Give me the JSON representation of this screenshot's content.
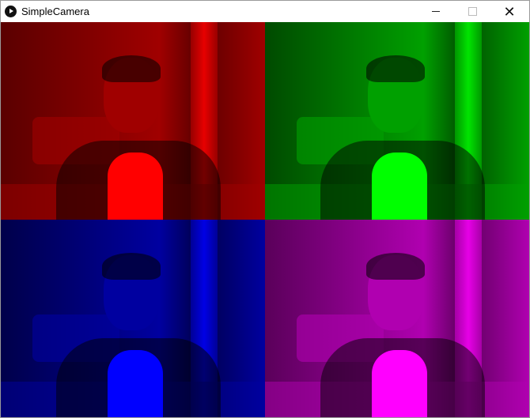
{
  "window": {
    "title": "SimpleCamera",
    "minimize": "minimize",
    "maximize": "maximize",
    "close": "close"
  },
  "feeds": [
    {
      "channel": "red",
      "color": "#ff0000",
      "dark": "#5a0000",
      "mid": "#a00000"
    },
    {
      "channel": "green",
      "color": "#00ff00",
      "dark": "#004a00",
      "mid": "#00a000"
    },
    {
      "channel": "blue",
      "color": "#0000ff",
      "dark": "#00004a",
      "mid": "#0000a0"
    },
    {
      "channel": "magenta",
      "color": "#ff00ff",
      "dark": "#5a005a",
      "mid": "#b000b0"
    }
  ]
}
